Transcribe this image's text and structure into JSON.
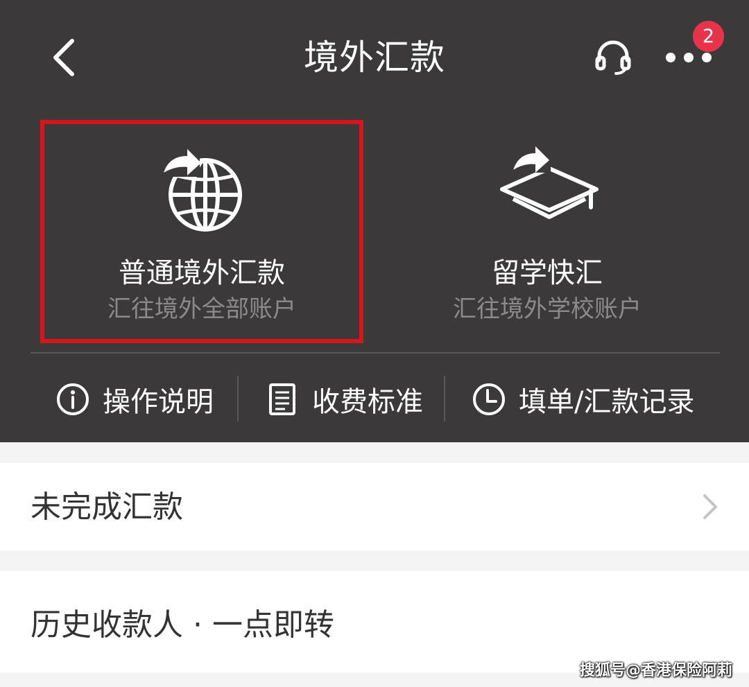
{
  "header": {
    "title": "境外汇款",
    "badge_count": "2",
    "icons": {
      "back": "chevron-left-icon",
      "service": "headset-icon",
      "more": "more-dots-icon"
    }
  },
  "cards": [
    {
      "title": "普通境外汇款",
      "subtitle": "汇往境外全部账户",
      "icon": "globe-transfer-icon",
      "selected": true
    },
    {
      "title": "留学快汇",
      "subtitle": "汇往境外学校账户",
      "icon": "graduation-cap-transfer-icon",
      "selected": false
    }
  ],
  "links": [
    {
      "label": "操作说明",
      "icon": "info-icon"
    },
    {
      "label": "收费标准",
      "icon": "document-icon"
    },
    {
      "label": "填单/汇款记录",
      "icon": "clock-icon"
    }
  ],
  "rows": [
    {
      "label": "未完成汇款",
      "has_chevron": true
    },
    {
      "label": "历史收款人 · 一点即转",
      "has_chevron": false
    }
  ],
  "watermark": "搜狐号@香港保险阿莉",
  "colors": {
    "header_bg": "#3b393a",
    "highlight_border": "#d6161c",
    "badge": "#e8344a",
    "subtitle": "#8c8a8b",
    "page_bg": "#f4f4f4"
  }
}
